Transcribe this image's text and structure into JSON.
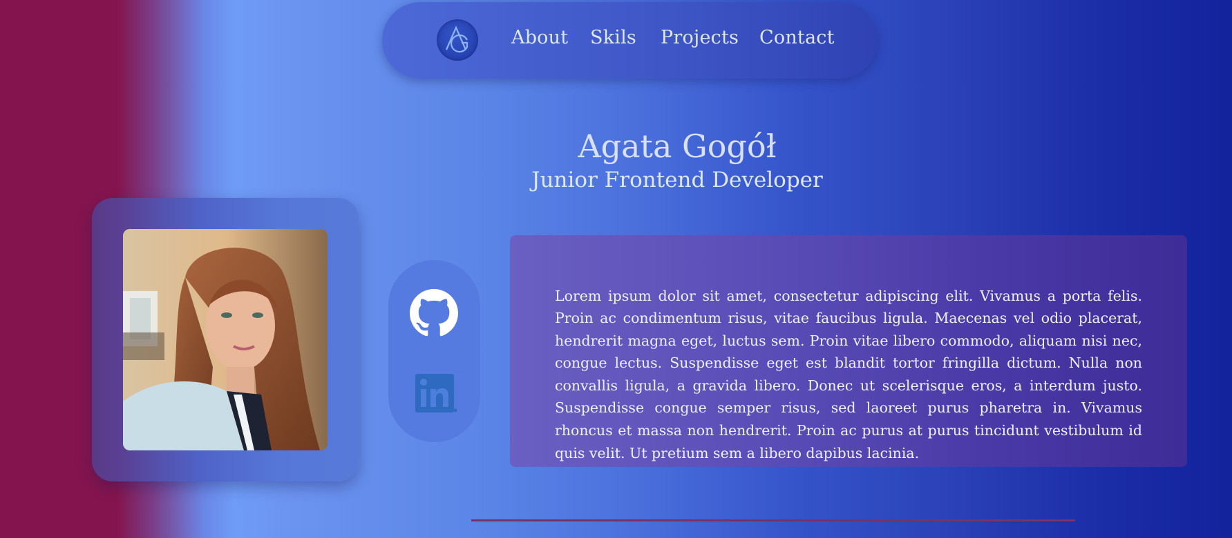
{
  "nav": {
    "logo_icon": "ag-monogram-logo",
    "links": [
      "About",
      "Skils",
      "Projects",
      "Contact"
    ]
  },
  "hero": {
    "name": "Agata Gogół",
    "role": "Junior Frontend Developer"
  },
  "social": {
    "github_icon": "github-icon",
    "linkedin_icon": "linkedin-icon"
  },
  "about": {
    "text": "Lorem ipsum dolor sit amet, consectetur adipiscing elit. Vivamus a porta felis. Proin ac condimentum risus, vitae faucibus ligula. Maecenas vel odio placerat, hendrerit magna eget, luctus sem. Proin vitae libero commodo, aliquam nisi nec, congue lectus. Suspendisse eget est blandit tortor fringilla dictum. Nulla non convallis ligula, a gravida libero. Donec ut scelerisque eros, a interdum justo. Suspendisse congue semper risus, sed laoreet purus pharetra in. Vivamus rhoncus et massa non hendrerit. Proin ac purus at purus tincidunt vestibulum id quis velit. Ut pretium sem a libero dapibus lacinia."
  },
  "colors": {
    "left_edge": "#84144e",
    "right_edge": "#12239c",
    "nav_bg": "#3e55c6",
    "about_bg": "#5a4cb6",
    "divider": "#7a2f6f",
    "text_light": "#dfe6f7"
  }
}
